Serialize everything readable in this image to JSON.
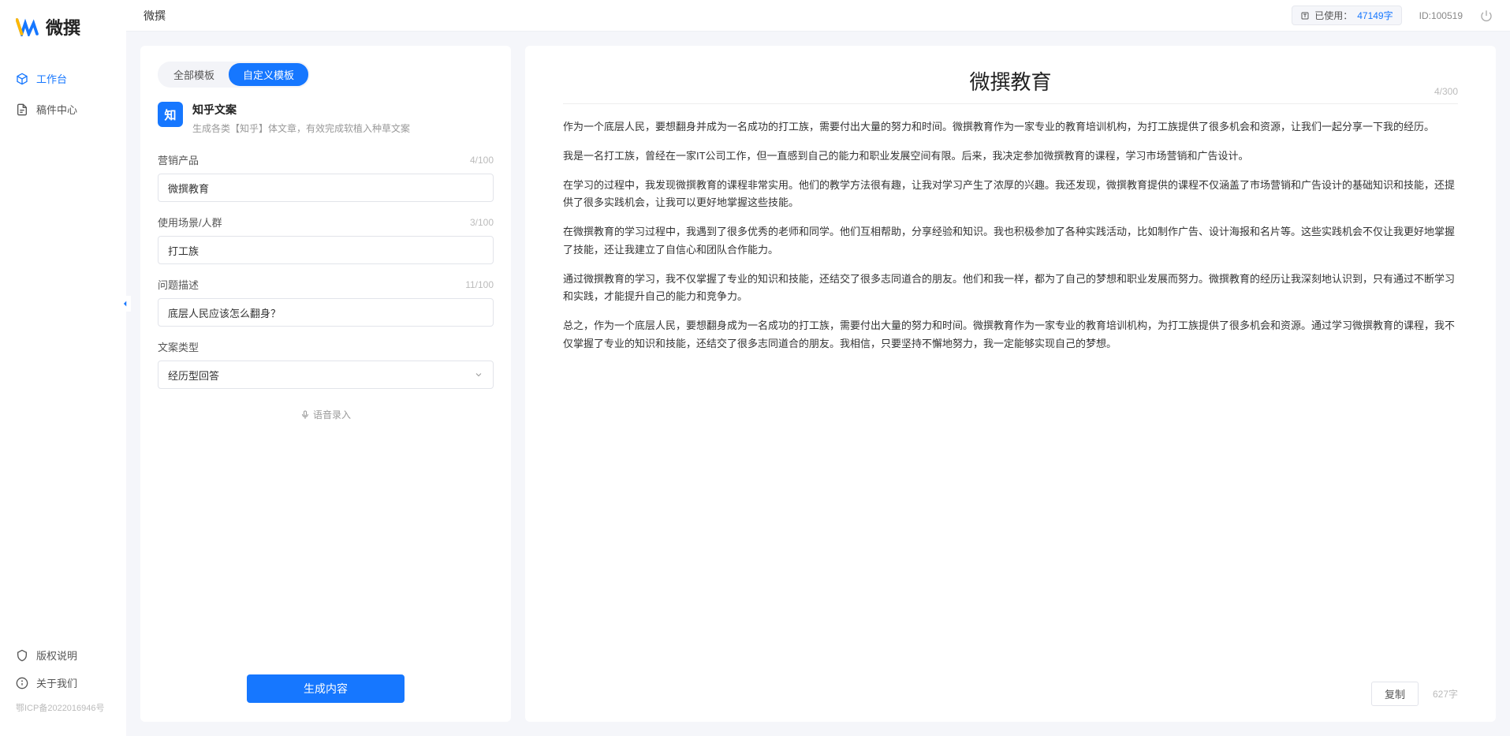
{
  "brand": {
    "name": "微撰"
  },
  "sidebar": {
    "items": [
      {
        "label": "工作台",
        "icon": "cube",
        "active": true
      },
      {
        "label": "稿件中心",
        "icon": "document",
        "active": false
      }
    ],
    "footer": [
      {
        "label": "版权说明",
        "icon": "shield"
      },
      {
        "label": "关于我们",
        "icon": "info"
      }
    ],
    "icp": "鄂ICP备2022016946号"
  },
  "topbar": {
    "title": "微撰",
    "usage_label": "已使用：",
    "usage_value": "47149字",
    "id_label": "ID:100519"
  },
  "left_panel": {
    "tabs": [
      {
        "label": "全部模板",
        "active": false
      },
      {
        "label": "自定义模板",
        "active": true
      }
    ],
    "template": {
      "icon_text": "知",
      "title": "知乎文案",
      "desc": "生成各类【知乎】体文章，有效完成软植入种草文案"
    },
    "fields": {
      "product": {
        "label": "营销产品",
        "value": "微撰教育",
        "counter": "4/100"
      },
      "scene": {
        "label": "使用场景/人群",
        "value": "打工族",
        "counter": "3/100"
      },
      "problem": {
        "label": "问题描述",
        "value": "底层人民应该怎么翻身？",
        "counter": "11/100"
      },
      "type": {
        "label": "文案类型",
        "value": "经历型回答"
      }
    },
    "voice_input": "语音录入",
    "generate_btn": "生成内容"
  },
  "right_panel": {
    "title": "微撰教育",
    "title_counter": "4/300",
    "paragraphs": [
      "作为一个底层人民，要想翻身并成为一名成功的打工族，需要付出大量的努力和时间。微撰教育作为一家专业的教育培训机构，为打工族提供了很多机会和资源，让我们一起分享一下我的经历。",
      "我是一名打工族，曾经在一家IT公司工作，但一直感到自己的能力和职业发展空间有限。后来，我决定参加微撰教育的课程，学习市场营销和广告设计。",
      "在学习的过程中，我发现微撰教育的课程非常实用。他们的教学方法很有趣，让我对学习产生了浓厚的兴趣。我还发现，微撰教育提供的课程不仅涵盖了市场营销和广告设计的基础知识和技能，还提供了很多实践机会，让我可以更好地掌握这些技能。",
      "在微撰教育的学习过程中，我遇到了很多优秀的老师和同学。他们互相帮助，分享经验和知识。我也积极参加了各种实践活动，比如制作广告、设计海报和名片等。这些实践机会不仅让我更好地掌握了技能，还让我建立了自信心和团队合作能力。",
      "通过微撰教育的学习，我不仅掌握了专业的知识和技能，还结交了很多志同道合的朋友。他们和我一样，都为了自己的梦想和职业发展而努力。微撰教育的经历让我深刻地认识到，只有通过不断学习和实践，才能提升自己的能力和竞争力。",
      "总之，作为一个底层人民，要想翻身成为一名成功的打工族，需要付出大量的努力和时间。微撰教育作为一家专业的教育培训机构，为打工族提供了很多机会和资源。通过学习微撰教育的课程，我不仅掌握了专业的知识和技能，还结交了很多志同道合的朋友。我相信，只要坚持不懈地努力，我一定能够实现自己的梦想。"
    ],
    "copy_btn": "复制",
    "char_count": "627字"
  }
}
